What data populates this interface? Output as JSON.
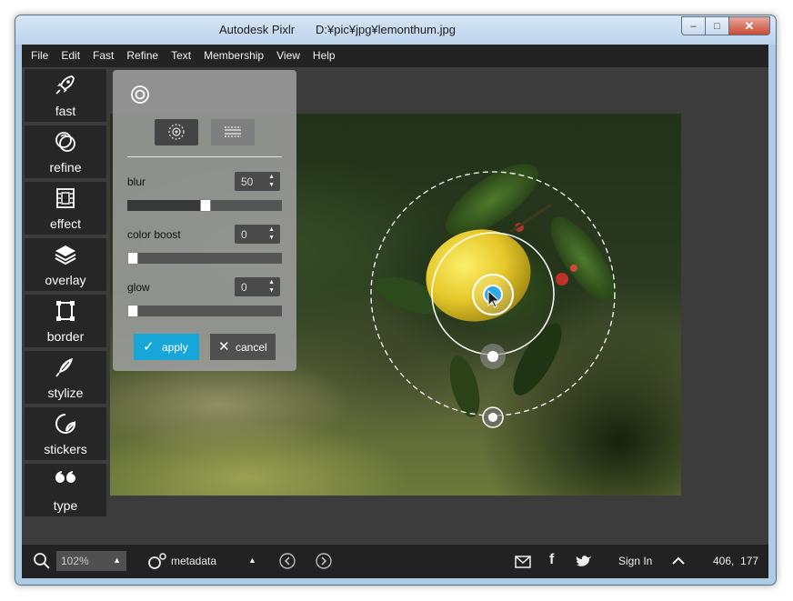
{
  "window": {
    "app_title": "Autodesk Pixlr",
    "file_path": "D:¥pic¥jpg¥lemonthum.jpg",
    "controls": {
      "minimize": "–",
      "maximize": "□",
      "close": "✕"
    }
  },
  "menu": [
    "File",
    "Edit",
    "Fast",
    "Refine",
    "Text",
    "Membership",
    "View",
    "Help"
  ],
  "tools": [
    {
      "label": "fast",
      "icon": "rocket-icon"
    },
    {
      "label": "refine",
      "icon": "refine-circles-icon"
    },
    {
      "label": "effect",
      "icon": "film-icon"
    },
    {
      "label": "overlay",
      "icon": "layers-icon"
    },
    {
      "label": "border",
      "icon": "frame-icon"
    },
    {
      "label": "stylize",
      "icon": "feather-icon"
    },
    {
      "label": "stickers",
      "icon": "sticker-icon"
    },
    {
      "label": "type",
      "icon": "quote-icon"
    }
  ],
  "panel": {
    "header_icon": "focus-target-icon",
    "modes": [
      {
        "icon": "radial-focus-icon",
        "active": true
      },
      {
        "icon": "linear-focus-icon",
        "active": false
      }
    ],
    "controls": [
      {
        "label": "blur",
        "value": "50",
        "level": 0.5
      },
      {
        "label": "color boost",
        "value": "0",
        "level": 0
      },
      {
        "label": "glow",
        "value": "0",
        "level": 0
      }
    ],
    "apply_label": "apply",
    "cancel_label": "cancel"
  },
  "status": {
    "zoom": "102%",
    "metadata_label": "metadata",
    "signin_label": "Sign In",
    "coords": "406,  177"
  },
  "colors": {
    "accent": "#17a6d8",
    "panel_bg": "#a0a0a0",
    "app_bg": "#3a3a3a",
    "bar_bg": "#232323"
  }
}
